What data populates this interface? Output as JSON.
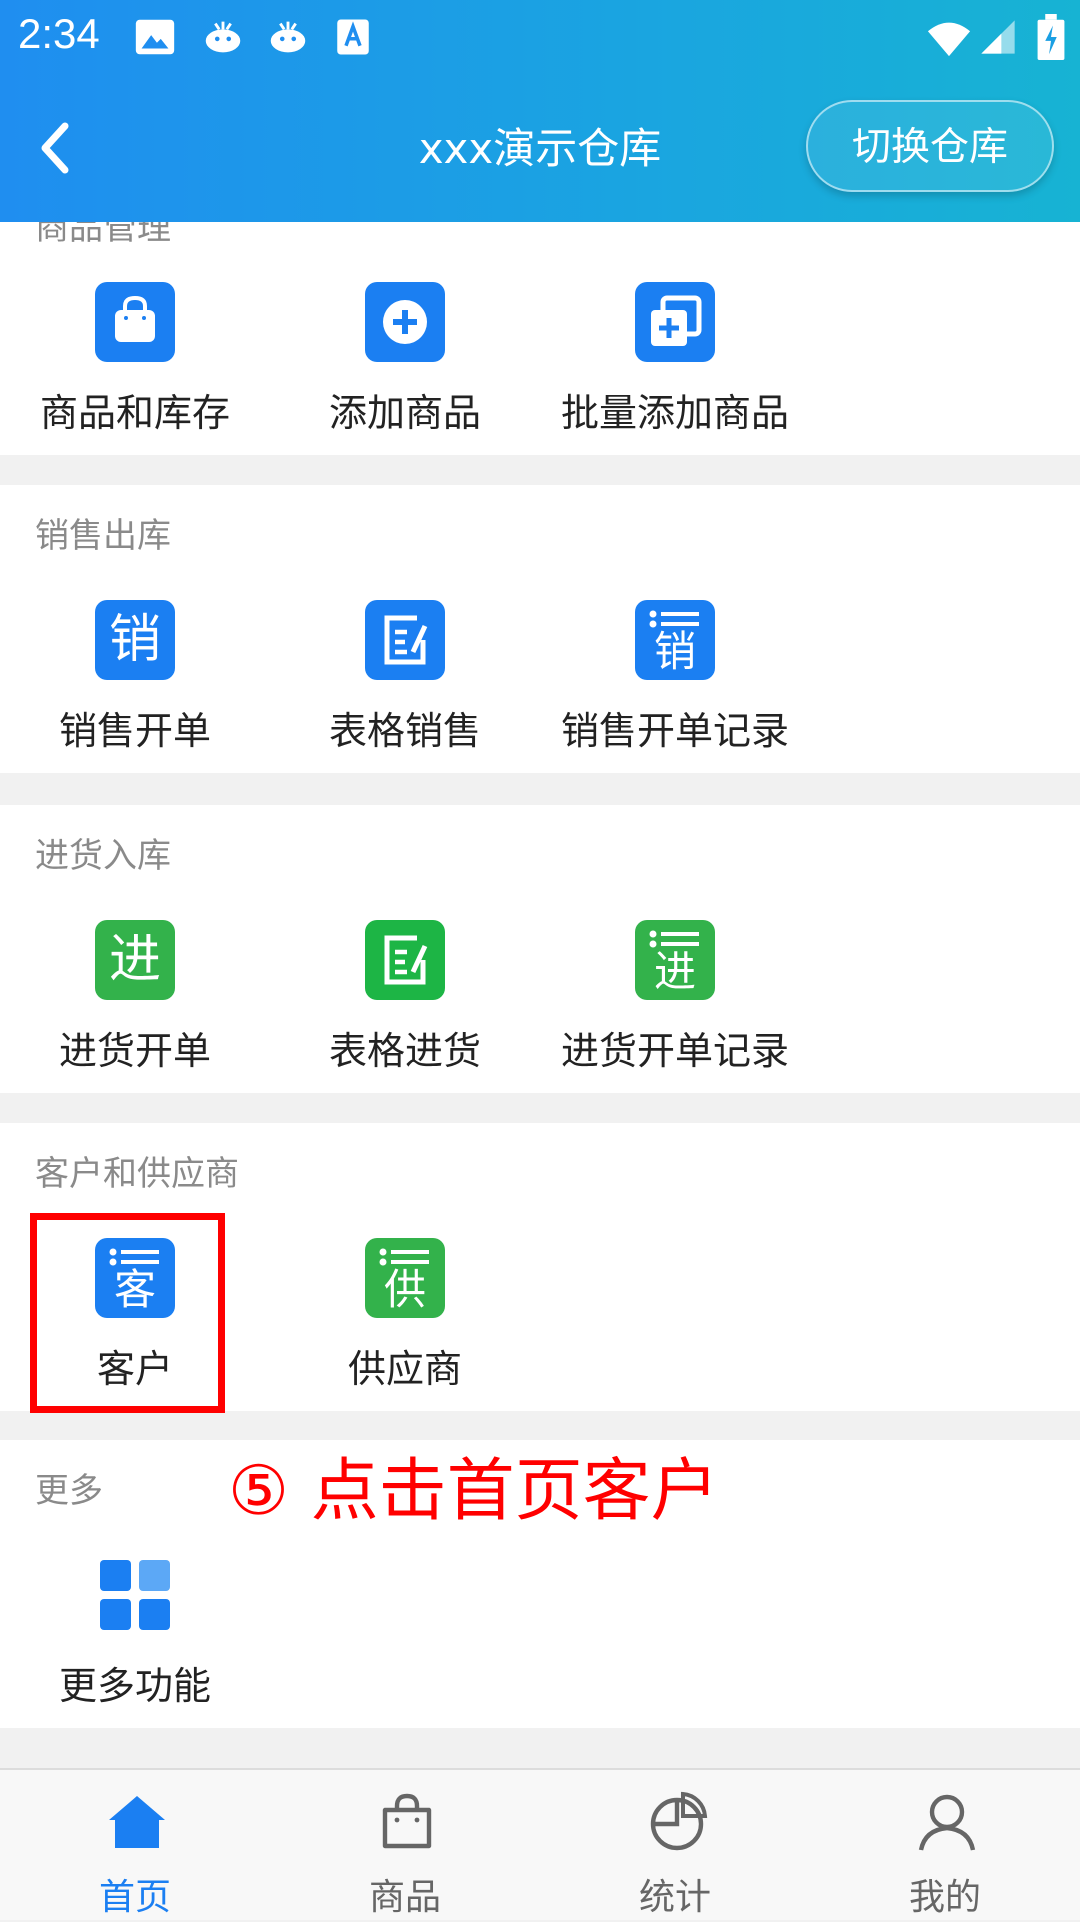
{
  "status_bar": {
    "time": "2:34",
    "icons": [
      "image-icon",
      "whale-icon",
      "whale-icon",
      "a-icon",
      "wifi-icon",
      "signal-icon",
      "battery-icon"
    ]
  },
  "header": {
    "title": "xxx演示仓库",
    "switch_button": "切换仓库"
  },
  "sections": {
    "goods": {
      "title": "商品管理",
      "items": [
        {
          "label": "商品和库存",
          "icon": "shopping-bag-icon",
          "color": "#1b7ff2"
        },
        {
          "label": "添加商品",
          "icon": "plus-circle-icon",
          "color": "#1b7ff2"
        },
        {
          "label": "批量添加商品",
          "icon": "batch-add-icon",
          "color": "#1b7ff2"
        }
      ]
    },
    "sales": {
      "title": "销售出库",
      "items": [
        {
          "label": "销售开单",
          "icon_char": "销",
          "color": "#1b7ff2"
        },
        {
          "label": "表格销售",
          "icon": "form-edit-icon",
          "color": "#1b7ff2"
        },
        {
          "label": "销售开单记录",
          "icon_char": "销",
          "color": "#1b7ff2"
        }
      ]
    },
    "purchase": {
      "title": "进货入库",
      "items": [
        {
          "label": "进货开单",
          "icon_char": "进",
          "color": "#33b24b"
        },
        {
          "label": "表格进货",
          "icon": "form-edit-icon",
          "color": "#1db545"
        },
        {
          "label": "进货开单记录",
          "icon_char": "进",
          "color": "#33b24b"
        }
      ]
    },
    "contacts": {
      "title": "客户和供应商",
      "items": [
        {
          "label": "客户",
          "icon_char": "客",
          "color": "#1b7ff2"
        },
        {
          "label": "供应商",
          "icon_char": "供",
          "color": "#33b24b"
        }
      ]
    },
    "more": {
      "title": "更多",
      "items": [
        {
          "label": "更多功能",
          "icon": "grid-icon",
          "color": "#1b7ff2"
        }
      ]
    }
  },
  "annotation": "⑤ 点击首页客户",
  "tabs": [
    {
      "label": "首页",
      "icon": "home-icon",
      "active": true
    },
    {
      "label": "商品",
      "icon": "bag-icon",
      "active": false
    },
    {
      "label": "统计",
      "icon": "pie-chart-icon",
      "active": false
    },
    {
      "label": "我的",
      "icon": "user-icon",
      "active": false
    }
  ]
}
